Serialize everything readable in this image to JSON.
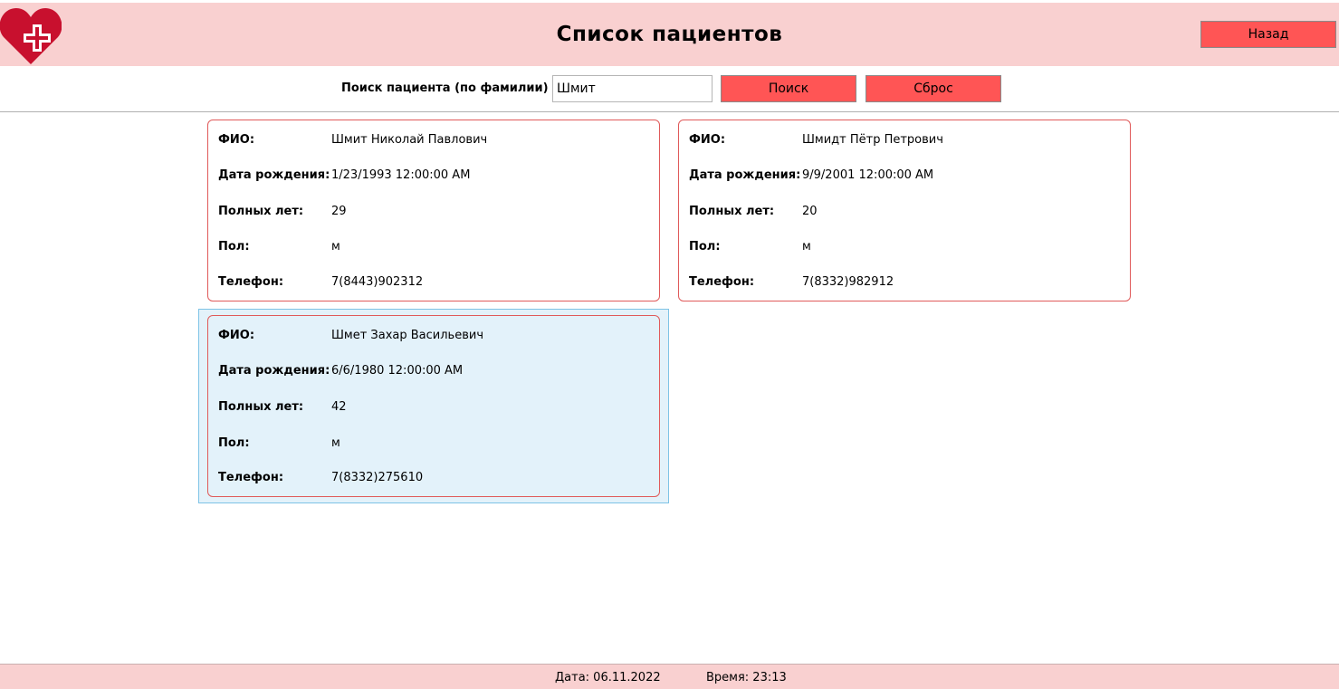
{
  "header": {
    "title": "Список пациентов",
    "back_label": "Назад",
    "logo_icon": "heart-plus-icon"
  },
  "search": {
    "label": "Поиск пациента (по фамилии)",
    "value": "Шмит",
    "search_label": "Поиск",
    "reset_label": "Сброс"
  },
  "field_labels": {
    "name": "ФИО:",
    "birth": "Дата рождения:",
    "age": "Полных лет:",
    "gender": "Пол:",
    "phone": "Телефон:"
  },
  "patients": [
    {
      "name": "Шмит Николай Павлович",
      "birth": "1/23/1993 12:00:00 AM",
      "age": "29",
      "gender": "м",
      "phone": "7(8443)902312"
    },
    {
      "name": "Шмидт Пётр Петрович",
      "birth": "9/9/2001 12:00:00 AM",
      "age": "20",
      "gender": "м",
      "phone": "7(8332)982912"
    },
    {
      "name": "Шмет Захар Васильевич",
      "birth": "6/6/1980 12:00:00 AM",
      "age": "42",
      "gender": "м",
      "phone": "7(8332)275610"
    }
  ],
  "footer": {
    "date": "Дата: 06.11.2022",
    "time": "Время: 23:13"
  },
  "colors": {
    "header_bg": "#f9d0d0",
    "button_bg": "#ff5555",
    "card_border": "#e05a5a",
    "selected_bg": "#e3f2fa",
    "logo": "#c8102e"
  }
}
